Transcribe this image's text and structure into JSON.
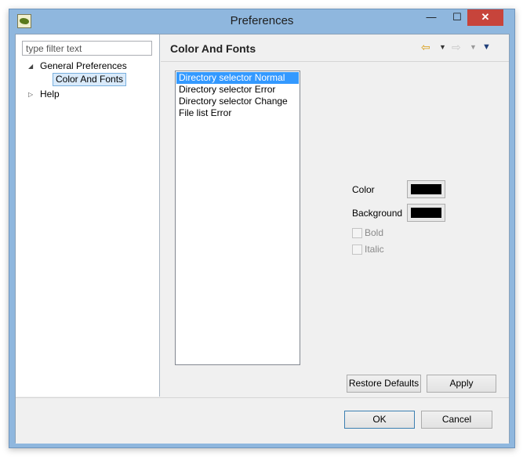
{
  "window": {
    "title": "Preferences",
    "minimize_glyph": "—",
    "maximize_glyph": "☐",
    "close_glyph": "✕"
  },
  "left_pane": {
    "filter_placeholder": "type filter text",
    "tree": [
      {
        "label": "General Preferences",
        "toggle": "◢",
        "expanded": true
      },
      {
        "label": "Color And Fonts",
        "selected": true
      },
      {
        "label": "Help",
        "toggle": "▷",
        "expanded": false
      }
    ]
  },
  "page": {
    "title": "Color And Fonts",
    "nav": {
      "back_glyph": "⇦",
      "dropdown_glyph": "▼",
      "forward_glyph": "⇨",
      "menu_glyph": "▼"
    },
    "list_items": [
      {
        "label": "Directory selector Normal",
        "selected": true
      },
      {
        "label": "Directory selector Error",
        "selected": false
      },
      {
        "label": "Directory selector Change",
        "selected": false
      },
      {
        "label": "File list Error",
        "selected": false
      }
    ],
    "properties": {
      "color_label": "Color",
      "color_value": "#000000",
      "background_label": "Background",
      "background_value": "#000000",
      "bold_label": "Bold",
      "bold_checked": false,
      "bold_enabled": false,
      "italic_label": "Italic",
      "italic_checked": false,
      "italic_enabled": false
    },
    "restore_defaults_label": "Restore Defaults",
    "apply_label": "Apply"
  },
  "footer": {
    "ok_label": "OK",
    "cancel_label": "Cancel"
  },
  "colors": {
    "selection": "#3399ff",
    "title_bar": "#8fb7de",
    "close_button": "#c7443b"
  }
}
